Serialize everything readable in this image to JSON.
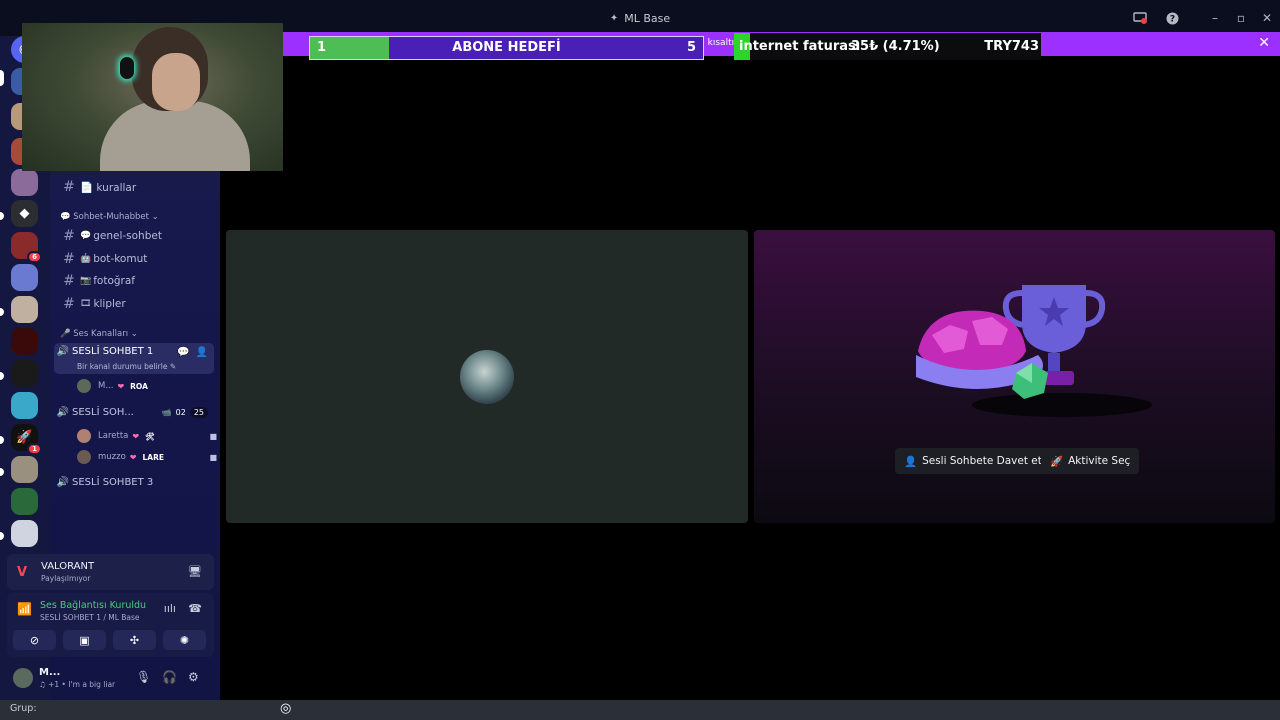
{
  "window": {
    "title": "ML Base",
    "controls": [
      "screen-share-icon",
      "help-icon",
      "minimize",
      "maximize",
      "close"
    ]
  },
  "promo": {
    "notice": "Yavaş Mod bu etkinleştirildi. Kullanıcı adları kısaltıldı.",
    "close_label": "✕"
  },
  "goal": {
    "title": "ABONE HEDEFİ",
    "current": "1",
    "target": "5",
    "progress": 0.2
  },
  "bill": {
    "name": "internet faturası",
    "amount_pct": "35₺ (4.71%)",
    "goal": "TRY743",
    "progress": 0.047
  },
  "servers": {
    "badges": [
      "6",
      "1"
    ]
  },
  "channels": {
    "top_channel": "📄 kurallar",
    "categories": [
      {
        "label": "💬 Sohbet-Muhabbet ⌄"
      },
      {
        "label": "🎤 Ses Kanalları ⌄"
      }
    ],
    "text": [
      {
        "emoji": "💬",
        "name": "genel-sohbet"
      },
      {
        "emoji": "🤖",
        "name": "bot-komut"
      },
      {
        "emoji": "📷",
        "name": "fotoğraf"
      },
      {
        "emoji": "🎞",
        "name": "klipler"
      }
    ],
    "voice": [
      {
        "name": "SESLİ SOHBET 1",
        "status": "Bir kanal durumu belirle ✎"
      },
      {
        "name": "SESLİ SOH...",
        "meta_a": "02",
        "meta_b": "25"
      },
      {
        "name": "SESLİ SOHBET 3"
      }
    ],
    "members_vc1": [
      {
        "name": "M...",
        "tag": "ROA"
      }
    ],
    "members_vc2": [
      {
        "name": "Laretta",
        "tag": "🛠"
      },
      {
        "name": "muzzo",
        "tag": "LARE"
      }
    ]
  },
  "activity": {
    "game": "VALORANT",
    "sub": "Paylaşılmıyor"
  },
  "voice_panel": {
    "state": "Ses Bağlantısı Kuruldu",
    "where": "SESLİ SOHBET 1 / ML Base"
  },
  "user": {
    "name": "M...",
    "status": "♫ +1 • I'm a big liar"
  },
  "stage": {
    "invite_label": "Sesli Sohbete Davet et",
    "activity_label": "Aktivite Seç"
  },
  "statusbar": {
    "label": "Grup:"
  },
  "colors": {
    "accent_purple": "#9b30ff",
    "goal_fill": "#4ebd54",
    "bill_fill": "#2ad62a",
    "connected_green": "#4ecb7a",
    "sidebar_bg": "#1a1c4e"
  }
}
